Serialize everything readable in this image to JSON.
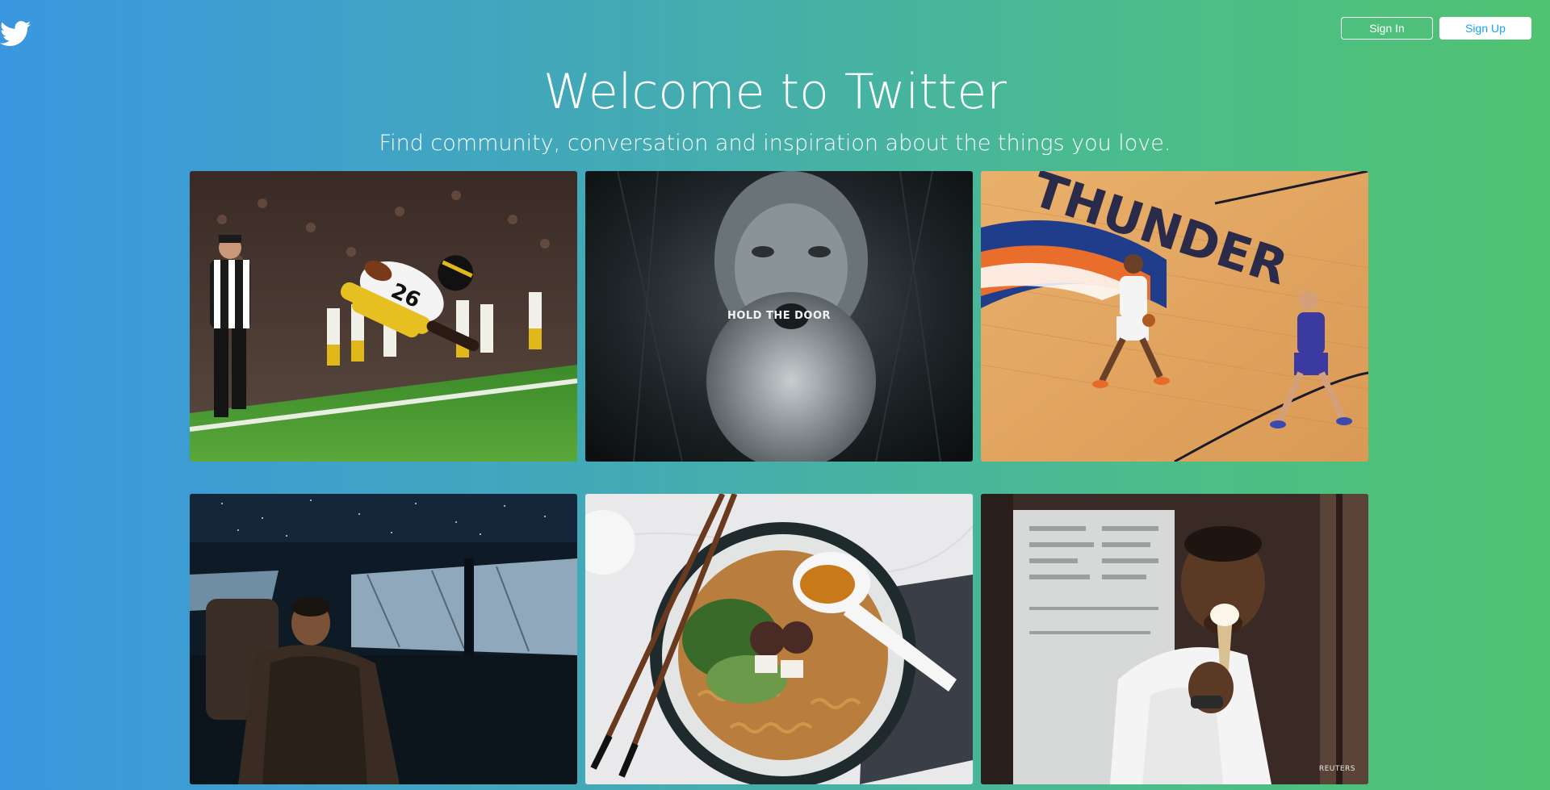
{
  "brand": {
    "logo_icon": "twitter-bird-icon",
    "accent": "#1da1f2",
    "gradient": [
      "#3a97e0",
      "#50c271"
    ]
  },
  "header": {
    "sign_in_label": "Sign In",
    "sign_up_label": "Sign Up"
  },
  "hero": {
    "title": "Welcome to Twitter",
    "subtitle": "Find community, conversation and inspiration about the things you love."
  },
  "tiles": [
    {
      "id": "football",
      "caption": "",
      "credit": ""
    },
    {
      "id": "hold-the-door",
      "caption": "HOLD THE DOOR",
      "credit": ""
    },
    {
      "id": "basketball",
      "caption": "",
      "credit": ""
    },
    {
      "id": "car-night",
      "caption": "",
      "credit": ""
    },
    {
      "id": "ramen",
      "caption": "",
      "credit": ""
    },
    {
      "id": "ice-cream",
      "caption": "",
      "credit": "REUTERS"
    }
  ]
}
